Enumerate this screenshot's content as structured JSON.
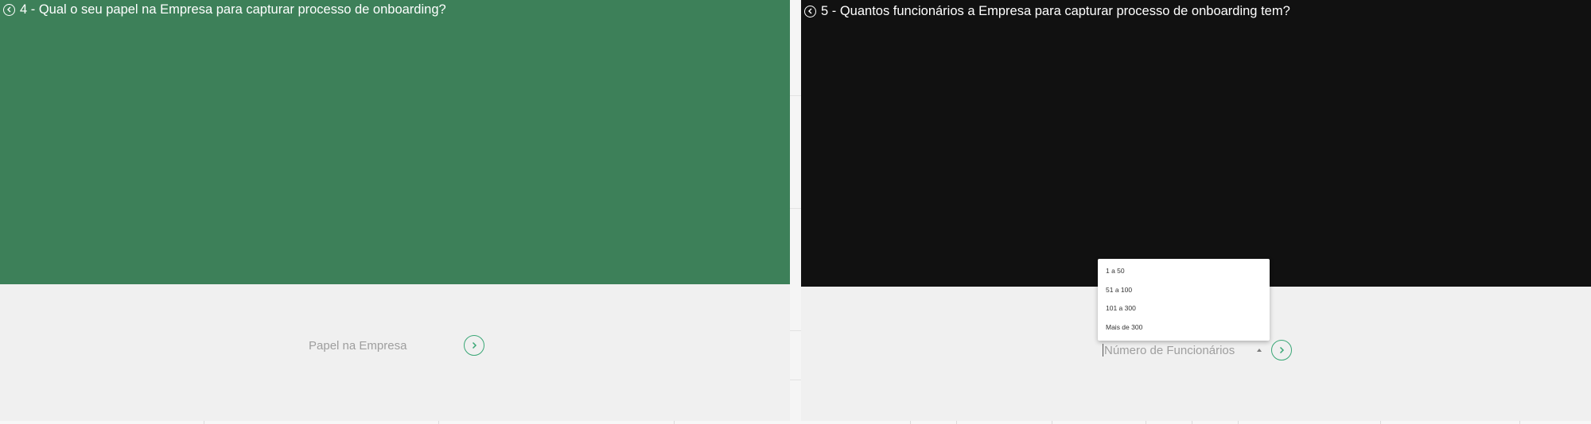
{
  "left_panel": {
    "hero_color": "#3d8059",
    "question": "4 - Qual o seu papel na Empresa para capturar processo de onboarding?",
    "back_icon": "chevron-left-circle-icon",
    "field_placeholder": "Papel na Empresa",
    "next_icon": "chevron-right-circle-icon"
  },
  "right_panel": {
    "hero_color": "#111111",
    "question": "5 - Quantos funcionários a Empresa para capturar processo de onboarding tem?",
    "back_icon": "chevron-left-circle-icon",
    "field_placeholder": "Número de Funcionários",
    "select_icon": "caret-up-icon",
    "next_icon": "chevron-right-circle-icon",
    "dropdown_options": [
      "1 a 50",
      "51 a 100",
      "101 a 300",
      "Mais de 300"
    ]
  },
  "colors": {
    "accent": "#3aa776",
    "page_background": "#f0f0f0"
  }
}
